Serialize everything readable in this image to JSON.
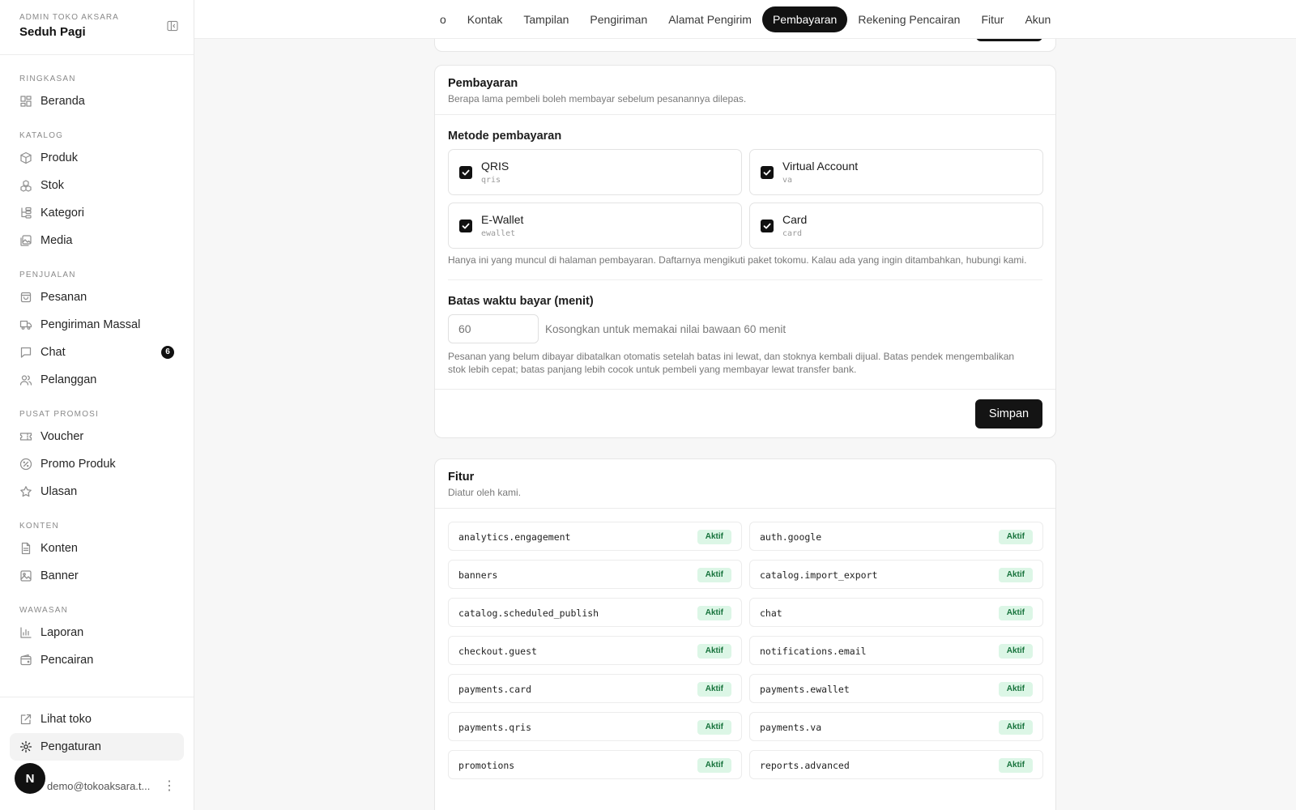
{
  "sidebar": {
    "brand_sub": "ADMIN TOKO AKSARA",
    "brand_name": "Seduh Pagi",
    "sections": [
      {
        "label": "RINGKASAN",
        "items": [
          {
            "label": "Beranda",
            "icon": "grid-icon"
          }
        ]
      },
      {
        "label": "KATALOG",
        "items": [
          {
            "label": "Produk",
            "icon": "box-icon"
          },
          {
            "label": "Stok",
            "icon": "boxes-icon"
          },
          {
            "label": "Kategori",
            "icon": "tree-icon"
          },
          {
            "label": "Media",
            "icon": "images-icon"
          }
        ]
      },
      {
        "label": "PENJUALAN",
        "items": [
          {
            "label": "Pesanan",
            "icon": "bag-icon"
          },
          {
            "label": "Pengiriman Massal",
            "icon": "truck-icon"
          },
          {
            "label": "Chat",
            "icon": "message-icon",
            "badge": "6"
          },
          {
            "label": "Pelanggan",
            "icon": "users-icon"
          }
        ]
      },
      {
        "label": "PUSAT PROMOSI",
        "items": [
          {
            "label": "Voucher",
            "icon": "ticket-icon"
          },
          {
            "label": "Promo Produk",
            "icon": "percent-icon"
          },
          {
            "label": "Ulasan",
            "icon": "star-icon"
          }
        ]
      },
      {
        "label": "KONTEN",
        "items": [
          {
            "label": "Konten",
            "icon": "file-icon"
          },
          {
            "label": "Banner",
            "icon": "image-icon"
          }
        ]
      },
      {
        "label": "WAWASAN",
        "items": [
          {
            "label": "Laporan",
            "icon": "chart-icon"
          },
          {
            "label": "Pencairan",
            "icon": "wallet-icon"
          }
        ]
      }
    ],
    "bottom": [
      {
        "label": "Lihat toko",
        "icon": "external-link-icon"
      },
      {
        "label": "Pengaturan",
        "icon": "gear-icon"
      }
    ],
    "user": {
      "initial": "N",
      "email": "demo@tokoaksara.t..."
    }
  },
  "tabs": [
    "o",
    "Kontak",
    "Tampilan",
    "Pengiriman",
    "Alamat Pengirim",
    "Pembayaran",
    "Rekening Pencairan",
    "Fitur",
    "Akun"
  ],
  "active_tab": "Pembayaran",
  "payment": {
    "title": "Pembayaran",
    "desc": "Berapa lama pembeli boleh membayar sebelum pesanannya dilepas.",
    "methods_label": "Metode pembayaran",
    "methods": [
      {
        "name": "QRIS",
        "code": "qris",
        "checked": true
      },
      {
        "name": "Virtual Account",
        "code": "va",
        "checked": true
      },
      {
        "name": "E-Wallet",
        "code": "ewallet",
        "checked": true
      },
      {
        "name": "Card",
        "code": "card",
        "checked": true
      }
    ],
    "methods_help": "Hanya ini yang muncul di halaman pembayaran. Daftarnya mengikuti paket tokomu. Kalau ada yang ingin ditambahkan, hubungi kami.",
    "timeout_label": "Batas waktu bayar (menit)",
    "timeout_placeholder": "60",
    "timeout_hint": "Kosongkan untuk memakai nilai bawaan 60 menit",
    "timeout_help": "Pesanan yang belum dibayar dibatalkan otomatis setelah batas ini lewat, dan stoknya kembali dijual. Batas pendek mengembalikan stok lebih cepat; batas panjang lebih cocok untuk pembeli yang membayar lewat transfer bank.",
    "save_label": "Simpan"
  },
  "features": {
    "title": "Fitur",
    "desc": "Diatur oleh kami.",
    "status_label": "Aktif",
    "items": [
      "analytics.engagement",
      "auth.google",
      "banners",
      "catalog.import_export",
      "catalog.scheduled_publish",
      "chat",
      "checkout.guest",
      "notifications.email",
      "payments.card",
      "payments.ewallet",
      "payments.qris",
      "payments.va",
      "promotions",
      "reports.advanced"
    ]
  },
  "colors": {
    "accent": "#121212",
    "active_pill_bg": "#dcf6e6",
    "active_pill_text": "#17733c"
  }
}
